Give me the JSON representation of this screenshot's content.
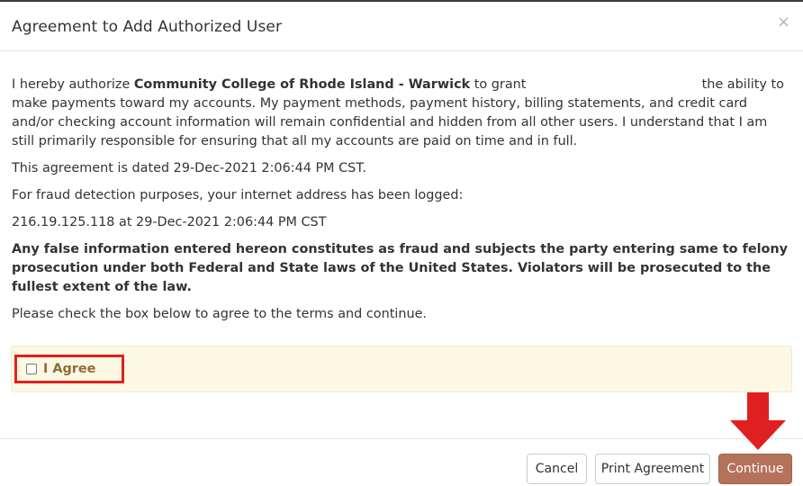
{
  "dialog": {
    "title": "Agreement to Add Authorized User",
    "close_glyph": "×"
  },
  "body": {
    "p1_pre": "I hereby authorize ",
    "institution": "Community College of Rhode Island - Warwick",
    "p1_mid": " to grant ",
    "p1_post": " the ability to make payments toward my accounts. My payment methods, payment history, billing statements, and credit card and/or checking account information will remain confidential and hidden from all other users. I understand that I am still primarily responsible for ensuring that all my accounts are paid on time and in full.",
    "dated": "This agreement is dated 29-Dec-2021 2:06:44 PM CST.",
    "fraud_notice": "For fraud detection purposes, your internet address has been logged:",
    "ip_log": "216.19.125.118 at 29-Dec-2021 2:06:44 PM CST",
    "warning": "Any false information entered hereon constitutes as fraud and subjects the party entering same to felony prosecution under both Federal and State laws of the United States. Violators will be prosecuted to the fullest extent of the law.",
    "instruction": "Please check the box below to agree to the terms and continue."
  },
  "agree": {
    "label": "I Agree",
    "checked": false
  },
  "footer": {
    "cancel_label": "Cancel",
    "print_label": "Print Agreement",
    "continue_label": "Continue"
  },
  "colors": {
    "accent": "#b5725a",
    "highlight_box": "#e02020",
    "panel_bg": "#fcf8e3",
    "label_text": "#8a6d3b"
  },
  "icons": {
    "close": "close-icon",
    "arrow": "arrow-down-icon"
  }
}
